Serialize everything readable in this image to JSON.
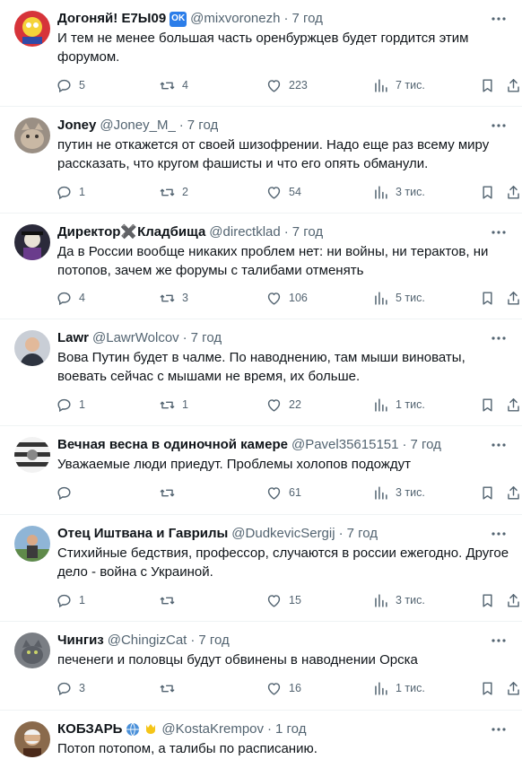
{
  "tweets": [
    {
      "name": "Догоняй! Е7Ы09",
      "badge": "OK",
      "handle": "@mixvoronezh",
      "time": "7 год",
      "text": "И тем не менее большая часть оренбуржцев будет гордится этим форумом.",
      "replies": "5",
      "retweets": "4",
      "likes": "223",
      "views": "7 тис.",
      "avatar_icon": "cartoon-avatar"
    },
    {
      "name": "Joney",
      "handle": "@Joney_M_",
      "time": "7 год",
      "text": "путин не откажется от своей шизофрении. Надо еще раз всему миру рассказать, что кругом фашисты и что его опять обманули.",
      "replies": "1",
      "retweets": "2",
      "likes": "54",
      "views": "3 тис.",
      "avatar_icon": "cat-photo-avatar"
    },
    {
      "name": "Директор✖️Кладбища",
      "handle": "@directklad",
      "time": "7 год",
      "text": "Да в России вообще никаких проблем нет: ни войны, ни терактов, ни потопов, зачем же форумы с талибами отменять",
      "replies": "4",
      "retweets": "3",
      "likes": "106",
      "views": "5 тис.",
      "avatar_icon": "dark-character-avatar"
    },
    {
      "name": "Lawr",
      "handle": "@LawrWolcov",
      "time": "7 год",
      "text": "Вова Путин будет в чалме. По наводнению, там мыши виноваты, воевать сейчас с мышами не время, их больше.",
      "replies": "1",
      "retweets": "1",
      "likes": "22",
      "views": "1 тис.",
      "avatar_icon": "person-photo-avatar"
    },
    {
      "name": "Вечная весна в одиночной камере",
      "handle": "@Pavel35615151",
      "time": "7 год",
      "text": "Уважаемые люди приедут. Проблемы холопов подождут",
      "replies": "",
      "retweets": "",
      "likes": "61",
      "views": "3 тис.",
      "avatar_icon": "striped-avatar"
    },
    {
      "name": "Отец Иштвана и Гаврилы",
      "handle": "@DudkevicSergij",
      "time": "7 год",
      "text": "Стихийные бедствия, профессор, случаются в россии ежегодно. Другое дело - война с Украиной.",
      "replies": "1",
      "retweets": "",
      "likes": "15",
      "views": "3 тис.",
      "avatar_icon": "outdoor-photo-avatar"
    },
    {
      "name": "Чингиз",
      "handle": "@ChingizCat",
      "time": "7 год",
      "text": "печенеги и половцы будут обвинены в наводнении Орска",
      "replies": "3",
      "retweets": "",
      "likes": "16",
      "views": "1 тис.",
      "avatar_icon": "cat-avatar"
    },
    {
      "name": "КОБЗАРЬ",
      "handle": "@KostaKrempov",
      "time": "1 год",
      "text": "Потоп потопом, а талибы по расписанию.",
      "replies": "",
      "retweets": "",
      "likes": "",
      "views": "",
      "avatar_icon": "portrait-avatar"
    }
  ],
  "colors": {
    "text": "#0f1419",
    "muted": "#536471",
    "divider": "#eff3f4",
    "badge": "#2b7de9"
  }
}
